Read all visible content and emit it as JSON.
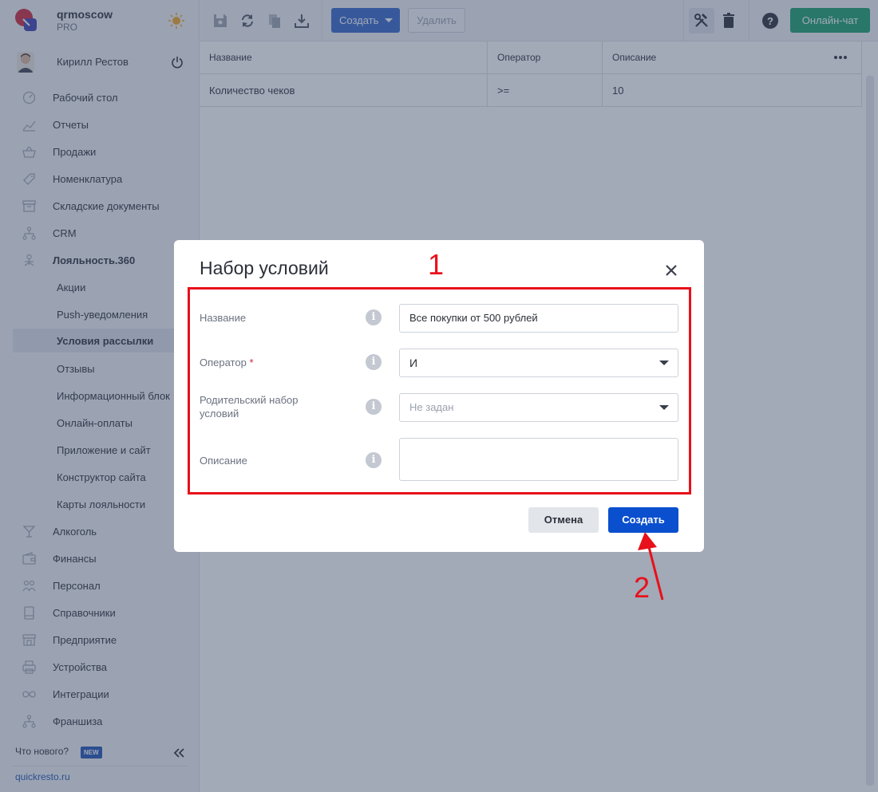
{
  "brand": {
    "name": "qrmoscow",
    "plan": "PRO"
  },
  "user": {
    "name": "Кирилл Рестов"
  },
  "sidebar": {
    "items": [
      {
        "label": "Рабочий стол",
        "icon": "dashboard-icon"
      },
      {
        "label": "Отчеты",
        "icon": "chart-icon"
      },
      {
        "label": "Продажи",
        "icon": "basket-icon"
      },
      {
        "label": "Номенклатура",
        "icon": "tag-icon"
      },
      {
        "label": "Складские документы",
        "icon": "box-icon"
      },
      {
        "label": "CRM",
        "icon": "network-icon"
      },
      {
        "label": "Лояльность.360",
        "icon": "loyalty-icon"
      }
    ],
    "subitems": [
      {
        "label": "Акции"
      },
      {
        "label": "Push-уведомления"
      },
      {
        "label": "Условия рассылки"
      },
      {
        "label": "Отзывы"
      },
      {
        "label": "Информационный блок"
      },
      {
        "label": "Онлайн-оплаты"
      },
      {
        "label": "Приложение и сайт"
      },
      {
        "label": "Конструктор сайта"
      },
      {
        "label": "Карты лояльности"
      }
    ],
    "items_bottom": [
      {
        "label": "Алкоголь",
        "icon": "cocktail-icon"
      },
      {
        "label": "Финансы",
        "icon": "wallet-icon"
      },
      {
        "label": "Персонал",
        "icon": "people-icon"
      },
      {
        "label": "Справочники",
        "icon": "book-icon"
      },
      {
        "label": "Предприятие",
        "icon": "store-icon"
      },
      {
        "label": "Устройства",
        "icon": "printer-icon"
      },
      {
        "label": "Интеграции",
        "icon": "infinity-icon"
      },
      {
        "label": "Франшиза",
        "icon": "network-icon"
      }
    ],
    "whats_new": "Что нового?",
    "new_badge": "NEW",
    "site_link": "quickresto.ru"
  },
  "toolbar": {
    "create_label": "Создать",
    "delete_label": "Удалить",
    "chat_label": "Онлайн-чат"
  },
  "table": {
    "headers": [
      "Название",
      "Оператор",
      "Описание"
    ],
    "rows": [
      [
        "Количество чеков",
        ">=",
        "10"
      ]
    ]
  },
  "modal": {
    "title": "Набор условий",
    "fields": {
      "name_label": "Название",
      "name_value": "Все покупки от 500 рублей",
      "operator_label": "Оператор",
      "operator_required": "*",
      "operator_value": "И",
      "parent_label": "Родительский набор условий",
      "parent_placeholder": "Не задан",
      "description_label": "Описание",
      "description_value": ""
    },
    "cancel_label": "Отмена",
    "create_label": "Создать"
  },
  "annotations": {
    "box_number": "1",
    "arrow_number": "2"
  },
  "colors": {
    "accent": "#0a4fce",
    "chat": "#16a06a",
    "annotation": "#e8101a",
    "logo": "#d0243a"
  }
}
